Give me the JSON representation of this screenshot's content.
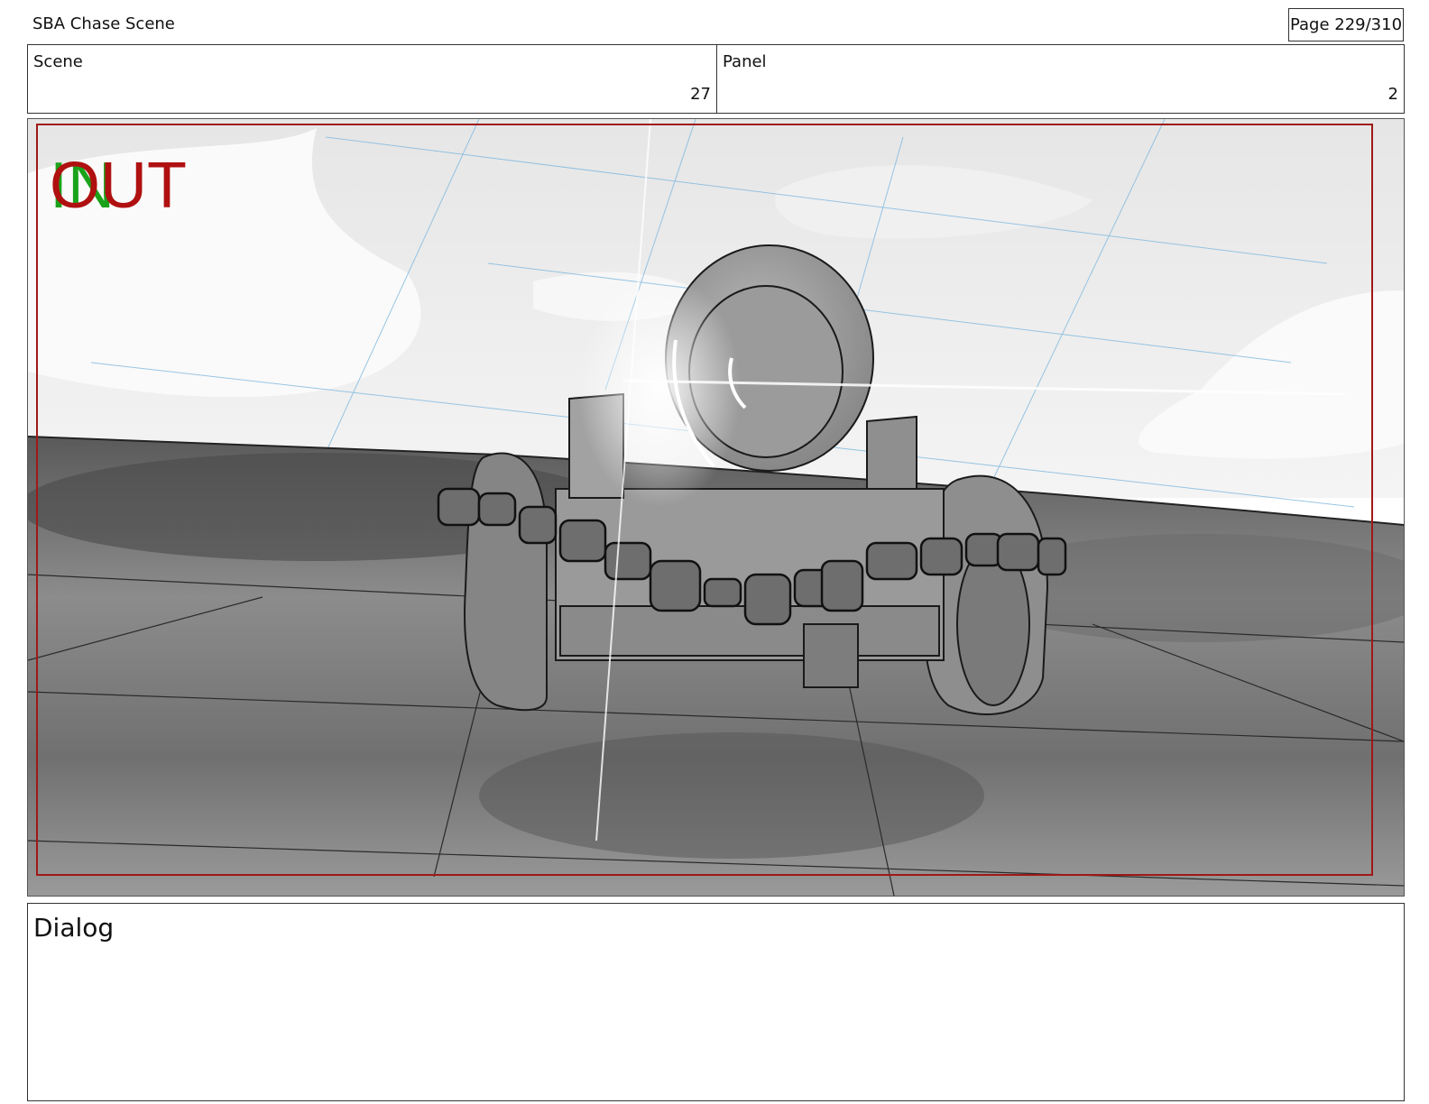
{
  "header": {
    "project_title": "SBA Chase Scene",
    "page": "Page 229/310"
  },
  "info": {
    "scene_label": "Scene",
    "scene_value": "27",
    "panel_label": "Panel",
    "panel_value": "2"
  },
  "frame": {
    "marker_in": "IN",
    "marker_out": "OUT",
    "marker_in_color": "#1aa31a",
    "marker_out_color": "#b01010",
    "border_color": "#a01818"
  },
  "dialog": {
    "label": "Dialog"
  }
}
